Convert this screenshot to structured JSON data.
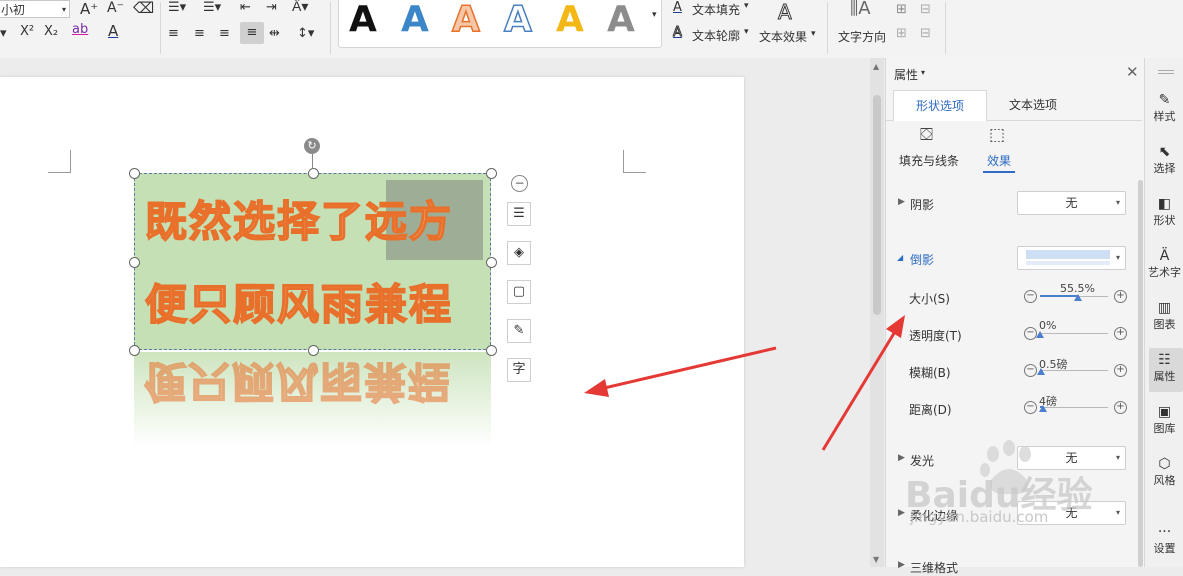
{
  "ribbon": {
    "font_size": "小初",
    "superscript": "X²",
    "subscript": "X₂",
    "wordart_letter": "A",
    "text_fill": "文本填充",
    "text_outline": "文本轮廓",
    "text_effect": "文本效果",
    "text_direction": "文字方向"
  },
  "document": {
    "line1": "既然选择了远方",
    "line2": "便只顾风雨兼程"
  },
  "panel": {
    "title": "属性",
    "tabs": [
      "形状选项",
      "文本选项"
    ],
    "subtabs": [
      "填充与线条",
      "效果"
    ],
    "shadow_label": "阴影",
    "shadow_value": "无",
    "reflection_label": "倒影",
    "sliders": [
      {
        "label": "大小(S)",
        "value_text": "55.5%",
        "fraction": 0.555
      },
      {
        "label": "透明度(T)",
        "value_text": "0%",
        "fraction": 0.0
      },
      {
        "label": "模糊(B)",
        "value_text": "0.5磅",
        "fraction": 0.02
      },
      {
        "label": "距离(D)",
        "value_text": "4磅",
        "fraction": 0.05
      }
    ],
    "glow_label": "发光",
    "glow_value": "无",
    "soft_edge_label": "柔化边缘",
    "soft_edge_value": "无",
    "three_d_label": "三维格式"
  },
  "right_toolbar": [
    "样式",
    "选择",
    "形状",
    "艺术字",
    "图表",
    "属性",
    "图库",
    "风格",
    "设置"
  ],
  "watermark": {
    "logo": "Baidu经验",
    "url": "jingyan.baidu.com"
  },
  "colors": {
    "accent": "#4a7fd0",
    "textbox_fill": "#c5e0b4",
    "wordart_fill": "#f4b183",
    "wordart_outline": "#e8702a",
    "arrow": "#e53935"
  }
}
